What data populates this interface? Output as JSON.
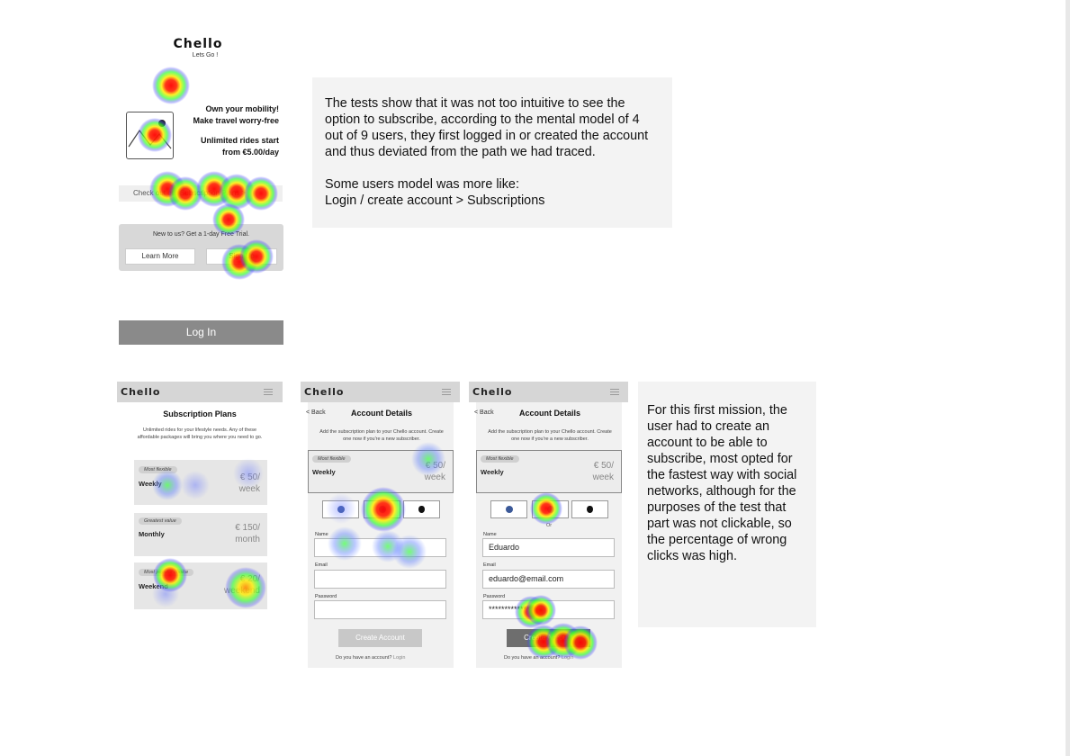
{
  "screen1": {
    "brand": "Chello",
    "tagline": "Lets Go !",
    "hero_line1": "Own your mobility!",
    "hero_line2": "Make travel worry-free",
    "hero_line3": "Unlimited rides start",
    "hero_line4": "from €5.00/day",
    "subscriptions_link": "Check out our Subscription Plans >",
    "trial_text": "New to us?  Get a 1-day Free Trial.",
    "learn_more": "Learn More",
    "sign_up": "Sign Up",
    "login": "Log In"
  },
  "note1": {
    "paragraph1": "The tests show that it was not too intuitive to see the option to subscribe, according to the mental model of 4 out of 9 users, they first logged in or created the account and thus deviated from the path we had traced.",
    "paragraph2_line1": "Some users model was more like:",
    "paragraph2_line2": "Login / create account > Subscriptions"
  },
  "screen2": {
    "brand": "Chello",
    "title": "Subscription Plans",
    "subtitle": "Unlimited rides for your lifestyle needs. Any of these affordable packages will bring you where you need to go.",
    "plans": [
      {
        "badge": "Most flexible",
        "name": "Weekly",
        "price": "€ 50/",
        "unit": "week"
      },
      {
        "badge": "Greatest value",
        "name": "Monthly",
        "price": "€ 150/",
        "unit": "month"
      },
      {
        "badge": "Most popular choice",
        "name": "Weekend",
        "price": "€ 20/",
        "unit": "weekend"
      }
    ]
  },
  "screen3": {
    "brand": "Chello",
    "back": "< Back",
    "title": "Account Details",
    "subtitle": "Add the subscription plan to your Chello account. Create one now if you're a new subscriber.",
    "plan": {
      "badge": "Most flexible",
      "name": "Weekly",
      "price": "€ 50/",
      "unit": "week"
    },
    "or": "Or",
    "name_label": "Name",
    "email_label": "Email",
    "password_label": "Password",
    "name_value": "",
    "email_value": "",
    "password_value": "",
    "create_button": "Create Account",
    "have_account": "Do you have an account?",
    "login_link": "Login"
  },
  "screen4": {
    "brand": "Chello",
    "back": "< Back",
    "title": "Account Details",
    "subtitle": "Add the subscription plan to your Chello account. Create one now if you're a new subscriber.",
    "plan": {
      "badge": "Most flexible",
      "name": "Weekly",
      "price": "€ 50/",
      "unit": "week"
    },
    "or": "Or",
    "name_label": "Name",
    "email_label": "Email",
    "password_label": "Password",
    "name_value": "Eduardo",
    "email_value": "eduardo@email.com",
    "password_value": "*************",
    "create_button": "Create Account",
    "have_account": "Do you have an account?",
    "login_link": "Login"
  },
  "note2": {
    "text": "For this first mission, the user had to create an account to be able to subscribe, most opted for the fastest way with social networks, although for the purposes of the test that part was not clickable, so the percentage of wrong clicks was high."
  },
  "colors": {
    "note_bg": "#f3f3f3",
    "header_bg": "#d6d6d6",
    "login_button": "#8a8a8a",
    "create_disabled": "#c8c8c8",
    "create_enabled": "#6e6e6e",
    "facebook": "#3b5998"
  },
  "icons": [
    "image-placeholder-icon",
    "menu-icon",
    "facebook-icon",
    "apple-icon"
  ]
}
